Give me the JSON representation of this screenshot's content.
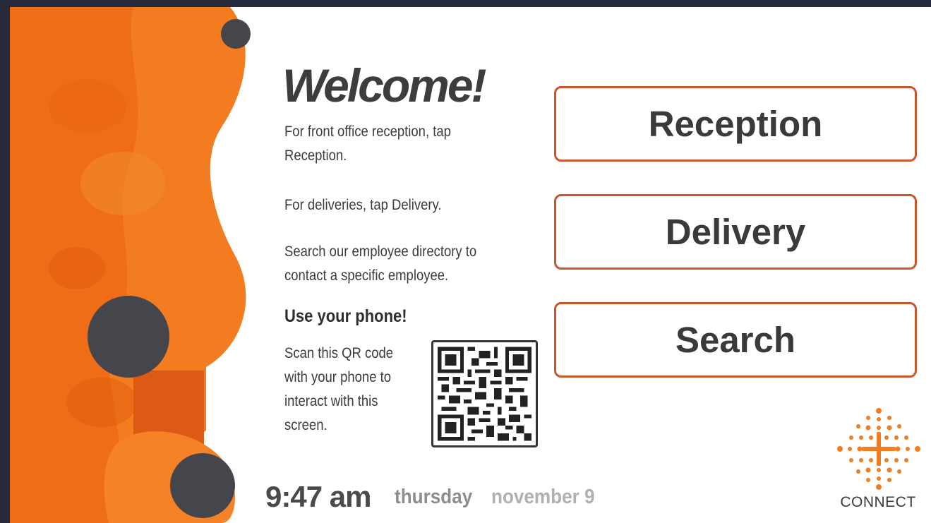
{
  "welcome": {
    "title": "Welcome!",
    "line_reception": "For front office reception, tap Reception.",
    "line_delivery": "For deliveries, tap Delivery.",
    "line_search": "Search our employee directory to contact a specific employee."
  },
  "phone": {
    "title": "Use your phone!",
    "instructions": "Scan this QR code with your phone to interact with this screen.",
    "qr_icon": "qr-code-icon"
  },
  "actions": {
    "reception": "Reception",
    "delivery": "Delivery",
    "search": "Search"
  },
  "clock": {
    "time": "9:47 am",
    "day": "thursday",
    "date": "november 9"
  },
  "brand": {
    "name": "CONNECT",
    "accent": "#f47c20",
    "button_border": "#c9552a",
    "dark_dot": "#44464b"
  }
}
